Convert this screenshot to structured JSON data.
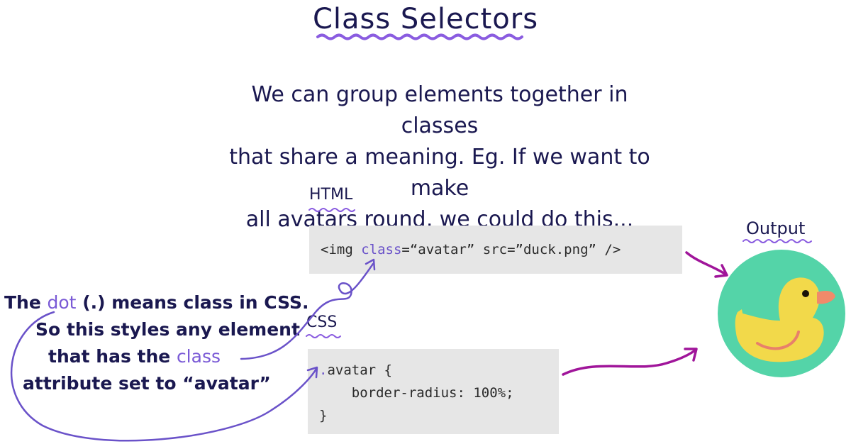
{
  "title": "Class Selectors",
  "intro": {
    "line1": "We can group elements together in classes",
    "line2": "that share a meaning. Eg. If we want to make",
    "line3": "all avatars round, we could do this..."
  },
  "html_section": {
    "label": "HTML",
    "code_before": "<img ",
    "code_keyword": "class",
    "code_after": "=“avatar” src=”duck.png” />"
  },
  "css_section": {
    "label": "CSS",
    "line1_dot": ".",
    "line1_rest": "avatar {",
    "line2": "    border-radius: 100%;",
    "line3": "}"
  },
  "output": {
    "label": "Output"
  },
  "note": {
    "l1_a": "The ",
    "l1_hl": "dot",
    "l1_b": " (.) means class in CSS.",
    "l2": "So this styles any element",
    "l3_a": "that has the ",
    "l3_hl": "class",
    "l4": "attribute set to “avatar”"
  },
  "colors": {
    "ink": "#1a1850",
    "highlight": "#7a5ad6",
    "arrow_purple": "#6a52c9",
    "arrow_magenta": "#a0159a",
    "squiggle": "#8a5ce0",
    "avatar_bg": "#54d4a8",
    "duck_body": "#f2d94a",
    "duck_beak": "#f08a6a",
    "duck_smile": "#e8806a",
    "code_bg": "#e6e6e6"
  }
}
